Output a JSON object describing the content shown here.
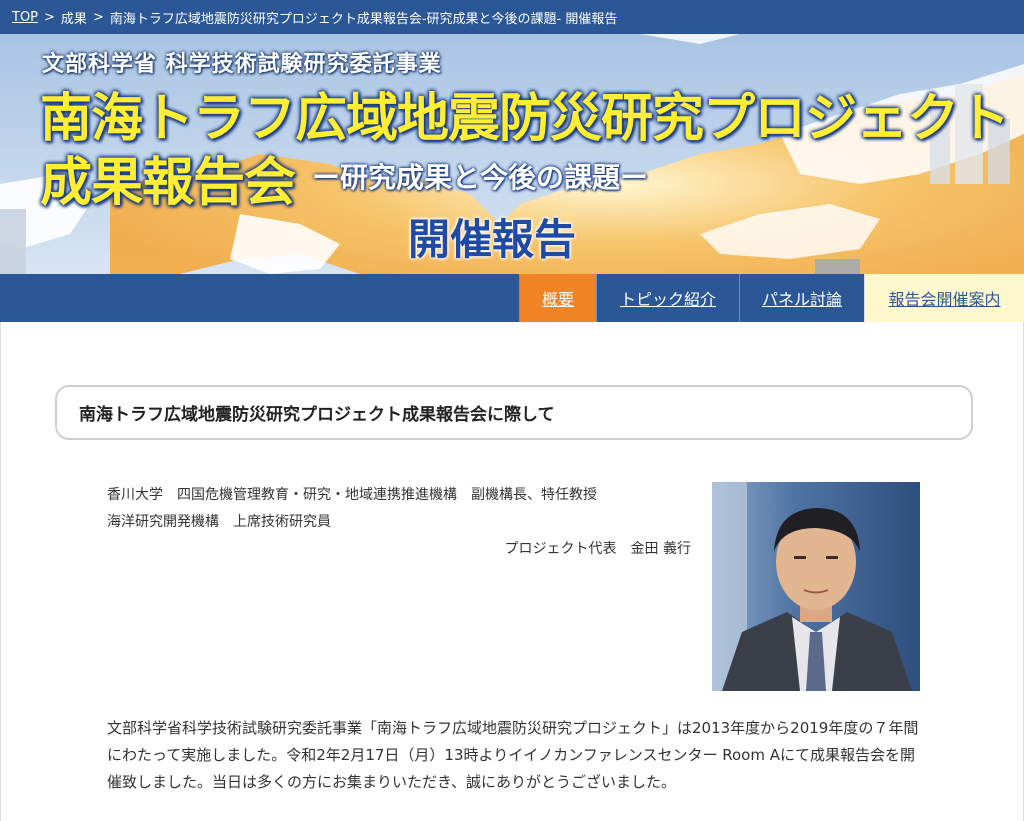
{
  "breadcrumb": {
    "top": "TOP",
    "sep1": ">",
    "results": "成果",
    "sep2": ">",
    "current": "南海トラフ広域地震防災研究プロジェクト成果報告会-研究成果と今後の課題- 開催報告"
  },
  "banner": {
    "line1": "文部科学省 科学技術試験研究委託事業",
    "line2": "南海トラフ広域地震防災研究プロジェクト",
    "line3": "成果報告会",
    "line3_sub": "ー研究成果と今後の課題ー",
    "line4": "開催報告"
  },
  "nav": {
    "items": [
      {
        "label": "概要"
      },
      {
        "label": "トピック紹介"
      },
      {
        "label": "パネル討論"
      },
      {
        "label": "報告会開催案内"
      }
    ]
  },
  "section": {
    "title": "南海トラフ広域地震防災研究プロジェクト成果報告会に際して"
  },
  "author": {
    "line1": "香川大学　四国危機管理教育・研究・地域連携推進機構　副機構長、特任教授",
    "line2": "海洋研究開発機構　上席技術研究員",
    "line3": "プロジェクト代表　金田 義行"
  },
  "body": {
    "paragraph": "文部科学省科学技術試験研究委託事業「南海トラフ広域地震防災研究プロジェクト」は2013年度から2019年度の７年間にわたって実施しました。令和2年2月17日（月）13時よりイイノカンファレンスセンター Room Aにて成果報告会を開催致しました。当日は多くの方にお集まりいただき、誠にありがとうございました。"
  },
  "colors": {
    "nav_bg": "#2b5797",
    "nav_active": "#f08323",
    "nav_highlight": "#fff8cc",
    "banner_title": "#ffee33"
  }
}
